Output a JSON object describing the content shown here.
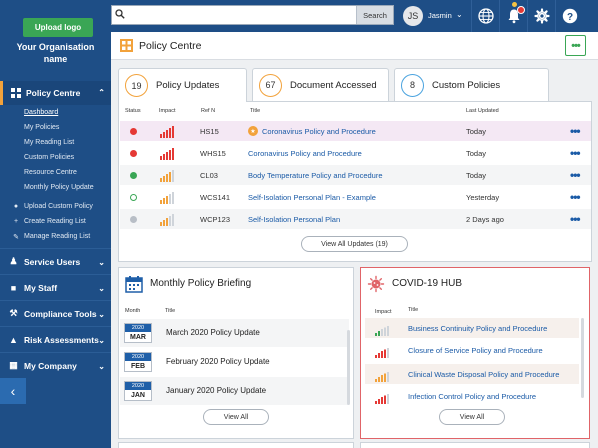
{
  "sidebar": {
    "upload_logo": "Upload logo",
    "org_name": "Your Organisation name",
    "policy_centre": {
      "label": "Policy Centre",
      "items": [
        "Dashboard",
        "My Policies",
        "My Reading List",
        "Custom Policies",
        "Resource Centre",
        "Monthly Policy Update"
      ],
      "actions": [
        "Upload Custom Policy",
        "Create Reading List",
        "Manage Reading List"
      ]
    },
    "sections": [
      "Service Users",
      "My Staff",
      "Compliance Tools",
      "Risk Assessments",
      "My Company"
    ]
  },
  "topbar": {
    "search_placeholder": "",
    "search_button": "Search",
    "avatar_initials": "JS",
    "user_name": "Jasmin"
  },
  "page": {
    "title": "Policy Centre",
    "more": "•••"
  },
  "tabs": [
    {
      "count": "19",
      "label": "Policy Updates",
      "color": "#f2a23b"
    },
    {
      "count": "67",
      "label": "Document Accessed",
      "color": "#f2a23b"
    },
    {
      "count": "8",
      "label": "Custom Policies",
      "color": "#4aa3df"
    }
  ],
  "updates": {
    "columns": {
      "status": "Status",
      "impact": "Impact",
      "ref": "Ref N",
      "title": "Title",
      "last_updated": "Last Updated"
    },
    "rows": [
      {
        "status": "red",
        "impact": 5,
        "ref": "HS15",
        "title": "Coronavirus Policy and Procedure",
        "last_updated": "Today",
        "highlight": true,
        "badge": true
      },
      {
        "status": "red",
        "impact": 5,
        "ref": "WHS15",
        "title": "Coronavirus Policy and Procedure",
        "last_updated": "Today"
      },
      {
        "status": "green",
        "impact": 4,
        "ref": "CL03",
        "title": "Body Temperature Policy and Procedure",
        "last_updated": "Today"
      },
      {
        "status": "green-hollow",
        "impact": 3,
        "ref": "WCS141",
        "title": "Self-Isolation Personal Plan - Example",
        "last_updated": "Yesterday"
      },
      {
        "status": "grey",
        "impact": 3,
        "ref": "WCP123",
        "title": "Self-Isolation Personal Plan",
        "last_updated": "2 Days ago"
      }
    ],
    "view_all": "View All  Updates (19)"
  },
  "briefing": {
    "title": "Monthly Policy Briefing",
    "col_month": "Month",
    "col_title": "Title",
    "rows": [
      {
        "year": "2020",
        "month": "MAR",
        "title": "March 2020 Policy Update"
      },
      {
        "year": "2020",
        "month": "FEB",
        "title": "February 2020 Policy Update"
      },
      {
        "year": "2020",
        "month": "JAN",
        "title": "January 2020 Policy Update"
      }
    ],
    "view_all": "View All"
  },
  "covid": {
    "title": "COVID-19 HUB",
    "col_impact": "Impact",
    "col_title": "Title",
    "rows": [
      {
        "impact": 2,
        "impact_color": "#3aa655",
        "title": "Business Continuity Policy and Procedure"
      },
      {
        "impact": 5,
        "impact_color": "#e53935",
        "title": "Closure of Service Policy and Procedure"
      },
      {
        "impact": 4,
        "impact_color": "#f2a23b",
        "title": "Clinical Waste Disposal Policy and Procedure"
      },
      {
        "impact": 5,
        "impact_color": "#e53935",
        "title": "Infection Control Policy and Procedure"
      }
    ],
    "view_all": "View All"
  },
  "colors": {
    "sidebar": "#1e4e86",
    "accent_green": "#3aa655",
    "accent_orange": "#f2a23b",
    "link_blue": "#1a5aa6",
    "status_red": "#e53935",
    "status_green": "#3aa655"
  }
}
